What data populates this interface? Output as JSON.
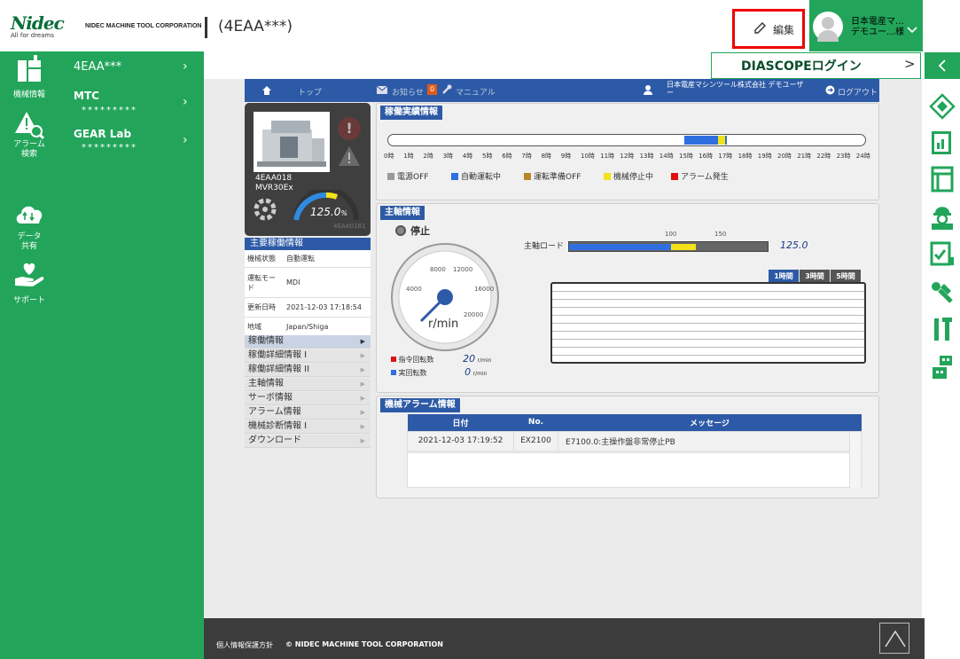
{
  "header": {
    "logo_brand": "Nidec",
    "logo_tag": "All for dreams",
    "corp": "NIDEC MACHINE TOOL CORPORATION",
    "title": "(4EAA***)",
    "edit_label": "編集",
    "user_name_1": "日本電産マ…",
    "user_name_2": "デモユー…様"
  },
  "diascope": {
    "label": "DIASCOPEログイン"
  },
  "left_nav": [
    {
      "label": "機械情報",
      "icon": "machine-icon"
    },
    {
      "label": "アラーム\n検索",
      "icon": "alarm-search-icon"
    },
    {
      "label": "データ\n共有",
      "icon": "cloud-share-icon"
    },
    {
      "label": "サポート",
      "icon": "support-hand-icon"
    }
  ],
  "sub_nav": [
    {
      "label": "4EAA***",
      "code": ""
    },
    {
      "label": "MTC",
      "code": "*********"
    },
    {
      "label": "GEAR Lab",
      "code": "*********"
    }
  ],
  "main_header": {
    "top": "トップ",
    "notice": "お知らせ",
    "notice_badge": "0",
    "manual": "マニュアル",
    "company": "日本電産マシンツール株式会社 デモユーザ",
    "company2": "ー",
    "logout": "ログアウト"
  },
  "machine_card": {
    "id": "4EAA018",
    "model": "MVR30Ex",
    "gauge": "125.0",
    "gauge_unit": "%",
    "code": "4EAA0181"
  },
  "ops": {
    "title": "稼働実績情報",
    "ticks": [
      "0時",
      "1時",
      "2時",
      "3時",
      "4時",
      "5時",
      "6時",
      "7時",
      "8時",
      "9時",
      "10時",
      "11時",
      "12時",
      "13時",
      "14時",
      "15時",
      "16時",
      "17時",
      "18時",
      "19時",
      "20時",
      "21時",
      "22時",
      "23時",
      "24時"
    ],
    "legend": [
      {
        "label": "電源OFF",
        "color": "#999999"
      },
      {
        "label": "自動運転中",
        "color": "#2f6fe0"
      },
      {
        "label": "運転準備OFF",
        "color": "#b8862a"
      },
      {
        "label": "機械停止中",
        "color": "#f3e11a"
      },
      {
        "label": "アラーム発生",
        "color": "#e01010"
      }
    ]
  },
  "main_info": {
    "title": "主要稼働情報",
    "rows": [
      [
        "機械状態",
        "自動運転"
      ],
      [
        "運転モード",
        "MDI"
      ],
      [
        "更新日時",
        "2021-12-03 17:18:54"
      ],
      [
        "地域",
        "Japan/Shiga"
      ]
    ]
  },
  "menu": [
    "稼働情報",
    "稼働詳細情報 I",
    "稼働詳細情報 II",
    "主軸情報",
    "サーボ情報",
    "アラーム情報",
    "機械診断情報 I",
    "ダウンロード"
  ],
  "spindle": {
    "title": "主軸情報",
    "status": "停止",
    "load_label": "主軸ロード",
    "load_val": "125.0",
    "mark100": "100",
    "mark150": "150",
    "tabs": [
      "1時間",
      "3時間",
      "5時間"
    ],
    "dial_labels": [
      "4000",
      "8000",
      "12000",
      "16000",
      "20000"
    ],
    "dial_unit": "r/min",
    "cmd_label": "指令回転数",
    "cmd_val": "20",
    "cmd_unit": "r/min",
    "act_label": "実回転数",
    "act_val": "0",
    "act_unit": "r/min"
  },
  "alarm": {
    "title": "機械アラーム情報",
    "headers": [
      "日付",
      "No.",
      "メッセージ"
    ],
    "rows": [
      [
        "2021-12-03 17:19:52",
        "EX2100",
        "E7100.0:主操作盤非常停止PB"
      ]
    ]
  },
  "footer": {
    "privacy": "個人情報保護方針",
    "copyright": "© NIDEC MACHINE TOOL CORPORATION"
  }
}
